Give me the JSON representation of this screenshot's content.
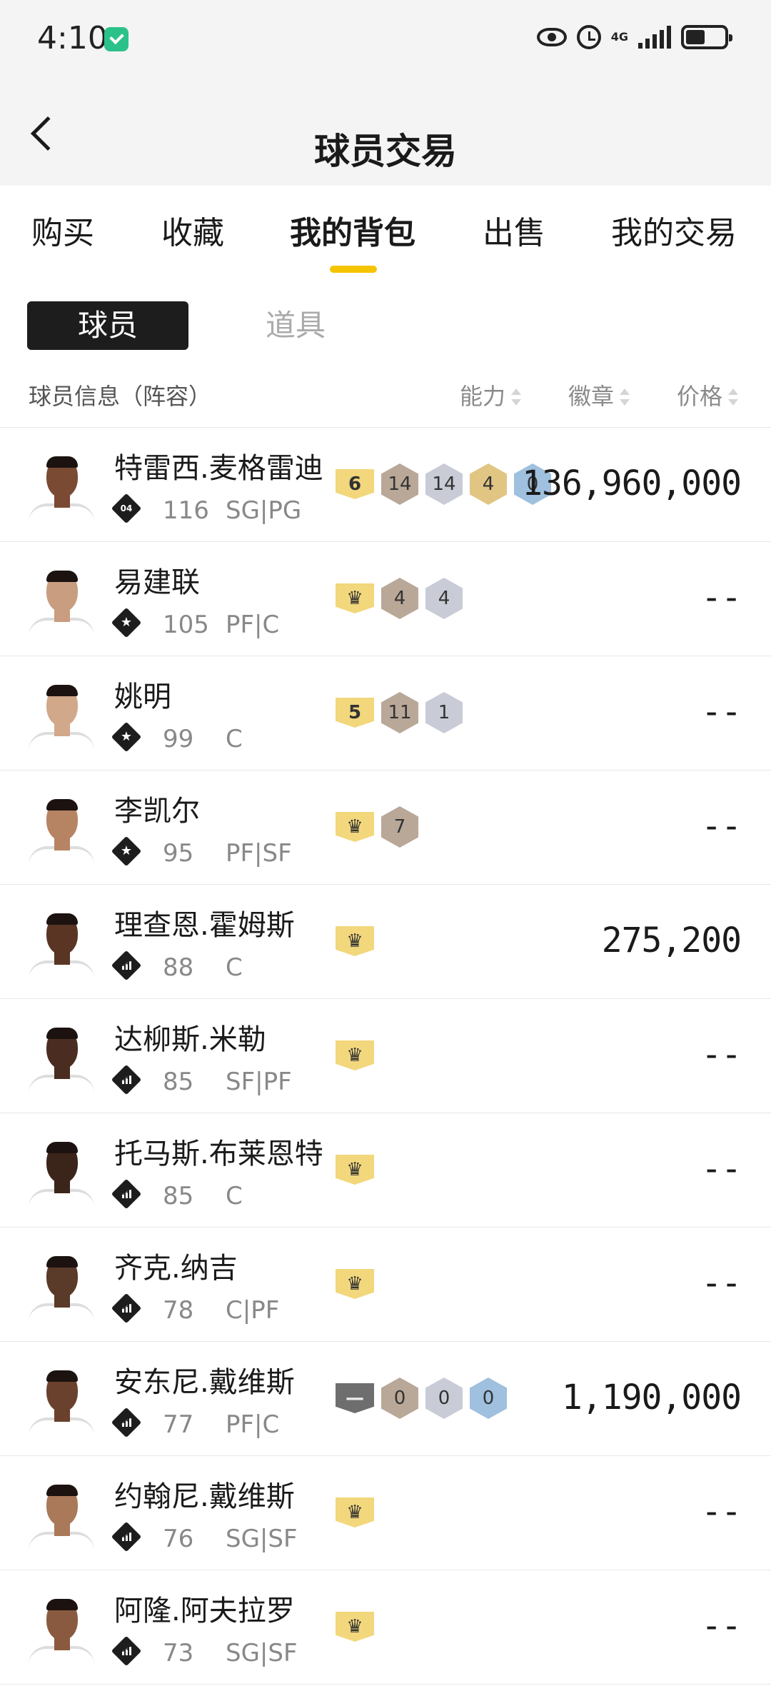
{
  "status_bar": {
    "time": "4:10",
    "network": "4G"
  },
  "header": {
    "title": "球员交易",
    "back_icon": "chevron-left-icon"
  },
  "tabs": [
    {
      "label": "购买",
      "active": false
    },
    {
      "label": "收藏",
      "active": false
    },
    {
      "label": "我的背包",
      "active": true
    },
    {
      "label": "出售",
      "active": false
    },
    {
      "label": "我的交易",
      "active": false
    }
  ],
  "segment": {
    "players": "球员",
    "items": "道具",
    "selected": "球员"
  },
  "columns": {
    "info": "球员信息（阵容）",
    "ability": "能力",
    "badges": "徽章",
    "price": "价格"
  },
  "accent_color": "#f5c400",
  "players": [
    {
      "name": "特雷西.麦格雷迪",
      "tier_icon": "04",
      "rating": "116",
      "position": "SG|PG",
      "badges": [
        {
          "type": "level",
          "value": "6"
        },
        {
          "type": "hex",
          "tone": "bronze",
          "value": "14"
        },
        {
          "type": "hex",
          "tone": "silver",
          "value": "14"
        },
        {
          "type": "hex",
          "tone": "gold",
          "value": "4"
        },
        {
          "type": "hex",
          "tone": "blue",
          "value": "0"
        }
      ],
      "price": "136,960,000"
    },
    {
      "name": "易建联",
      "tier_icon": "star",
      "rating": "105",
      "position": "PF|C",
      "badges": [
        {
          "type": "level",
          "value": "♛"
        },
        {
          "type": "hex",
          "tone": "bronze",
          "value": "4"
        },
        {
          "type": "hex",
          "tone": "silver",
          "value": "4"
        }
      ],
      "price": "--"
    },
    {
      "name": "姚明",
      "tier_icon": "star",
      "rating": "99",
      "position": "C",
      "badges": [
        {
          "type": "level",
          "value": "5"
        },
        {
          "type": "hex",
          "tone": "bronze",
          "value": "11"
        },
        {
          "type": "hex",
          "tone": "silver",
          "value": "1"
        }
      ],
      "price": "--"
    },
    {
      "name": "李凯尔",
      "tier_icon": "star",
      "rating": "95",
      "position": "PF|SF",
      "badges": [
        {
          "type": "level",
          "value": "♛"
        },
        {
          "type": "hex",
          "tone": "bronze",
          "value": "7"
        }
      ],
      "price": "--"
    },
    {
      "name": "理查恩.霍姆斯",
      "tier_icon": "bars",
      "rating": "88",
      "position": "C",
      "badges": [
        {
          "type": "level",
          "value": "♛"
        }
      ],
      "price": "275,200"
    },
    {
      "name": "达柳斯.米勒",
      "tier_icon": "bars",
      "rating": "85",
      "position": "SF|PF",
      "badges": [
        {
          "type": "level",
          "value": "♛"
        }
      ],
      "price": "--"
    },
    {
      "name": "托马斯.布莱恩特",
      "tier_icon": "bars",
      "rating": "85",
      "position": "C",
      "badges": [
        {
          "type": "level",
          "value": "♛"
        }
      ],
      "price": "--"
    },
    {
      "name": "齐克.纳吉",
      "tier_icon": "bars",
      "rating": "78",
      "position": "C|PF",
      "badges": [
        {
          "type": "level",
          "value": "♛"
        }
      ],
      "price": "--"
    },
    {
      "name": "安东尼.戴维斯",
      "tier_icon": "bars",
      "rating": "77",
      "position": "PF|C",
      "badges": [
        {
          "type": "level-gray",
          "value": "—"
        },
        {
          "type": "hex",
          "tone": "bronze",
          "value": "0"
        },
        {
          "type": "hex",
          "tone": "silver",
          "value": "0"
        },
        {
          "type": "hex",
          "tone": "blue",
          "value": "0"
        }
      ],
      "price": "1,190,000"
    },
    {
      "name": "约翰尼.戴维斯",
      "tier_icon": "bars",
      "rating": "76",
      "position": "SG|SF",
      "badges": [
        {
          "type": "level",
          "value": "♛"
        }
      ],
      "price": "--"
    },
    {
      "name": "阿隆.阿夫拉罗",
      "tier_icon": "bars",
      "rating": "73",
      "position": "SG|SF",
      "badges": [
        {
          "type": "level",
          "value": "♛"
        }
      ],
      "price": "--"
    }
  ]
}
